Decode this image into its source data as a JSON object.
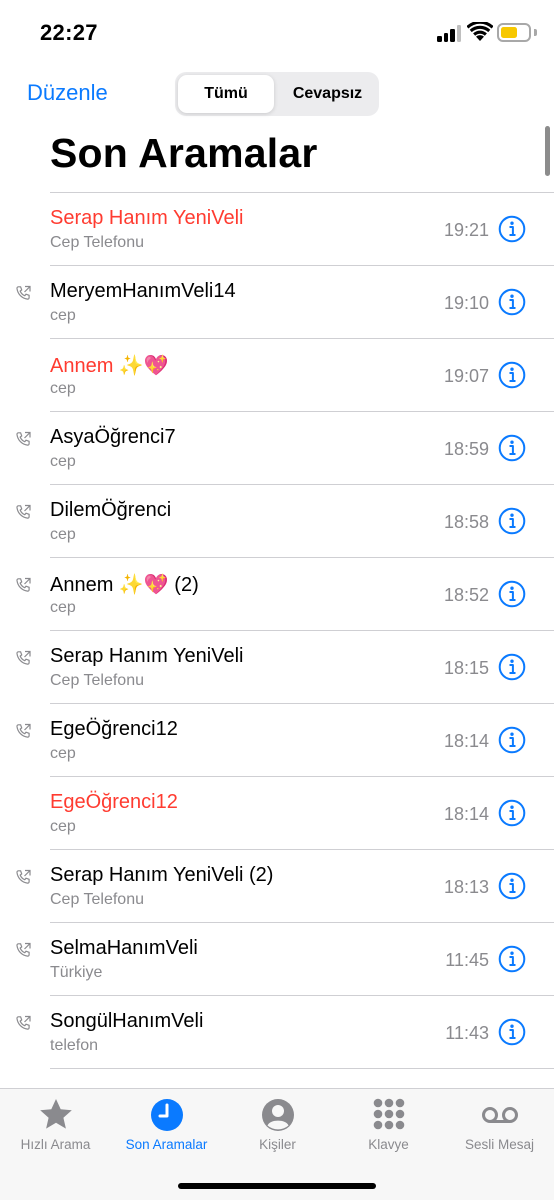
{
  "status_bar": {
    "time": "22:27"
  },
  "nav": {
    "edit_label": "Düzenle",
    "segments": [
      "Tümü",
      "Cevapsız"
    ],
    "title": "Son Aramalar"
  },
  "calls": [
    {
      "name": "Serap Hanım YeniVeli",
      "type": "Cep Telefonu",
      "time": "19:21",
      "missed": true,
      "outgoing": false
    },
    {
      "name": "MeryemHanımVeli14",
      "type": "cep",
      "time": "19:10",
      "missed": false,
      "outgoing": true
    },
    {
      "name": "Annem ✨💖",
      "type": "cep",
      "time": "19:07",
      "missed": true,
      "outgoing": false
    },
    {
      "name": "AsyaÖğrenci7",
      "type": "cep",
      "time": "18:59",
      "missed": false,
      "outgoing": true
    },
    {
      "name": "DilemÖğrenci",
      "type": "cep",
      "time": "18:58",
      "missed": false,
      "outgoing": true
    },
    {
      "name": "Annem ✨💖 (2)",
      "type": "cep",
      "time": "18:52",
      "missed": false,
      "outgoing": true
    },
    {
      "name": "Serap Hanım YeniVeli",
      "type": "Cep Telefonu",
      "time": "18:15",
      "missed": false,
      "outgoing": true
    },
    {
      "name": "EgeÖğrenci12",
      "type": "cep",
      "time": "18:14",
      "missed": false,
      "outgoing": true
    },
    {
      "name": "EgeÖğrenci12",
      "type": "cep",
      "time": "18:14",
      "missed": true,
      "outgoing": false
    },
    {
      "name": "Serap Hanım YeniVeli (2)",
      "type": "Cep Telefonu",
      "time": "18:13",
      "missed": false,
      "outgoing": true
    },
    {
      "name": "SelmaHanımVeli",
      "type": "Türkiye",
      "time": "11:45",
      "missed": false,
      "outgoing": true
    },
    {
      "name": "SongülHanımVeli",
      "type": "telefon",
      "time": "11:43",
      "missed": false,
      "outgoing": true
    }
  ],
  "tab_bar": {
    "active": "son-aramalar",
    "tabs": [
      {
        "id": "hizli-arama",
        "label": "Hızlı Arama",
        "icon": "star-icon"
      },
      {
        "id": "son-aramalar",
        "label": "Son Aramalar",
        "icon": "clock-icon"
      },
      {
        "id": "kisiler",
        "label": "Kişiler",
        "icon": "person-circle-icon"
      },
      {
        "id": "klavye",
        "label": "Klavye",
        "icon": "keypad-icon"
      },
      {
        "id": "sesli-mesaj",
        "label": "Sesli Mesaj",
        "icon": "voicemail-icon"
      }
    ]
  },
  "colors": {
    "accent": "#0a7aff",
    "missed": "#ff3b30",
    "secondary_text": "#8a8a8e",
    "battery": "#f7c800"
  }
}
